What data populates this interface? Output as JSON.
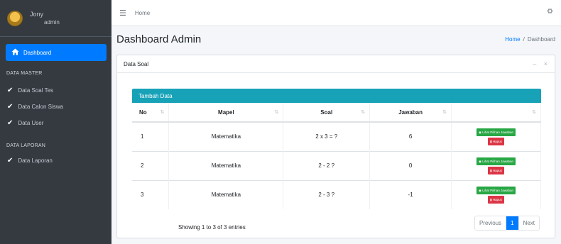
{
  "sidebar": {
    "user_name": "Jony",
    "user_role": "admin",
    "active_item": {
      "label": "Dashboard",
      "icon": "home-icon"
    },
    "sections": [
      {
        "header": "DATA MASTER",
        "items": [
          {
            "label": "Data Soal Tes",
            "icon": "check-icon"
          },
          {
            "label": "Data Calon Siswa",
            "icon": "check-icon"
          },
          {
            "label": "Data User",
            "icon": "check-icon"
          }
        ]
      },
      {
        "header": "DATA LAPORAN",
        "items": [
          {
            "label": "Data Laporan",
            "icon": "check-icon"
          }
        ]
      }
    ]
  },
  "navbar": {
    "home_link": "Home",
    "menu_icon": "hamburger-icon",
    "settings_icon": "gear-icon"
  },
  "content": {
    "title": "Dashboard Admin",
    "breadcrumb": {
      "home": "Home",
      "separator": "/",
      "current": "Dashboard"
    }
  },
  "card": {
    "title": "Data Soal",
    "tools": {
      "collapse": "–",
      "close": "×"
    },
    "table_header_bar": "Tambah Data",
    "columns": [
      "No",
      "Mapel",
      "Soal",
      "Jawaban",
      ""
    ],
    "rows": [
      {
        "no": "1",
        "mapel": "Matematika",
        "soal": "2 x 3 = ?",
        "jawaban": "6",
        "lihat": "Lihat Pilihan Jawaban",
        "hapus": "Hapus"
      },
      {
        "no": "2",
        "mapel": "Matematika",
        "soal": "2 - 2 ?",
        "jawaban": "0",
        "lihat": "Lihat Pilihan Jawaban",
        "hapus": "Hapus"
      },
      {
        "no": "3",
        "mapel": "Matematika",
        "soal": "2 - 3 ?",
        "jawaban": "-1",
        "lihat": "Lihat Pilihan Jawaban",
        "hapus": "Hapus"
      }
    ],
    "showing": "Showing 1 to 3 of 3 entries",
    "pagination": {
      "previous": "Previous",
      "current": "1",
      "next": "Next"
    }
  },
  "colors": {
    "sidebar_bg": "#343a40",
    "active": "#007bff",
    "tambah_bar": "#17a2b8",
    "btn_lihat": "#28a745",
    "btn_hapus": "#dc3545"
  }
}
